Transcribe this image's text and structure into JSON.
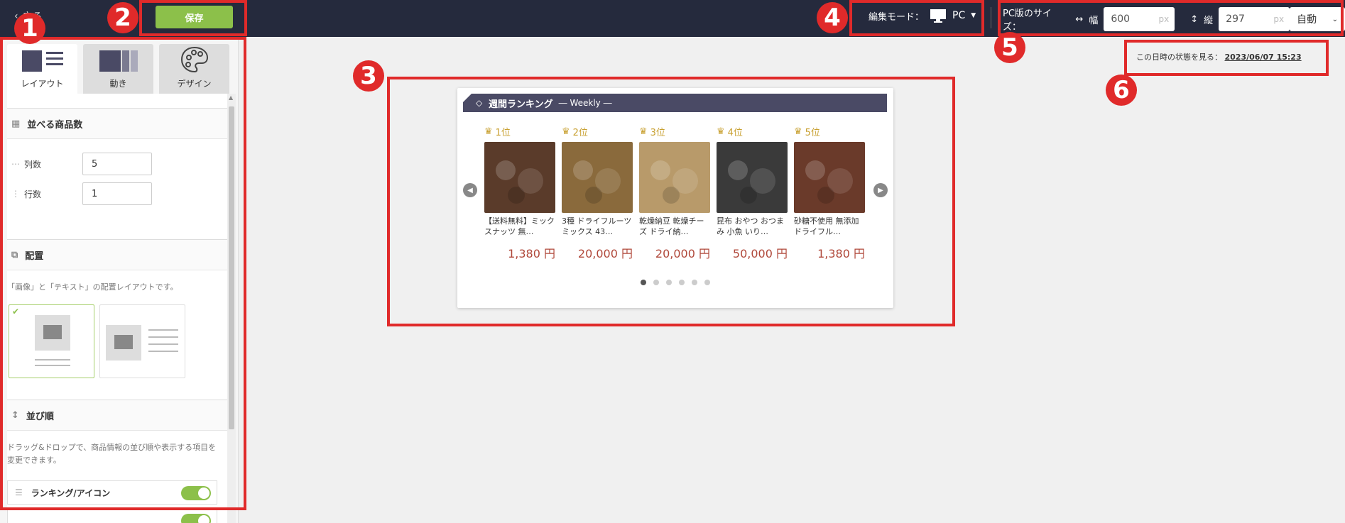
{
  "topbar": {
    "back_label": "戻る",
    "save_label": "保存",
    "edit_mode_label": "編集モード：",
    "edit_mode_value": "PC",
    "size_label": "PC版のサイズ：",
    "width_label": "幅",
    "width_value": "600",
    "height_label": "縦",
    "height_value": "297",
    "unit": "px",
    "height_mode": "自動"
  },
  "annotations": [
    "1",
    "2",
    "3",
    "4",
    "5",
    "6"
  ],
  "tabs": [
    {
      "label": "レイアウト",
      "icon": "layout-icon",
      "active": true
    },
    {
      "label": "動き",
      "icon": "motion-icon",
      "active": false
    },
    {
      "label": "デザイン",
      "icon": "palette-icon",
      "active": false
    }
  ],
  "sections": {
    "count": {
      "title": "並べる商品数",
      "cols_label": "列数",
      "cols_value": "5",
      "rows_label": "行数",
      "rows_value": "1"
    },
    "placement": {
      "title": "配置",
      "desc": "「画像」と「テキスト」の配置レイアウトです。"
    },
    "order": {
      "title": "並び順",
      "desc": "ドラッグ&ドロップで、商品情報の並び順や表示する項目を変更できます。",
      "row1": "ランキング/アイコン"
    }
  },
  "datetime": {
    "label": "この日時の状態を見る：",
    "value": "2023/06/07 15:23"
  },
  "widget": {
    "title": "週間ランキング",
    "subtitle": "― Weekly ―",
    "items": [
      {
        "rank": "1位",
        "name": "【送料無料】ミックスナッツ 無…",
        "price": "1,380 円",
        "color": "#5a3b2a"
      },
      {
        "rank": "2位",
        "name": "3種 ドライフルーツ ミックス 43…",
        "price": "20,000 円",
        "color": "#8a6a3c"
      },
      {
        "rank": "3位",
        "name": "乾燥納豆 乾燥チーズ ドライ納…",
        "price": "20,000 円",
        "color": "#b89a6a"
      },
      {
        "rank": "4位",
        "name": "昆布 おやつ おつまみ 小魚 いり…",
        "price": "50,000 円",
        "color": "#3a3a3a"
      },
      {
        "rank": "5位",
        "name": "砂糖不使用 無添加 ドライフル…",
        "price": "1,380 円",
        "color": "#6a3a2a"
      }
    ],
    "dot_count": 6,
    "active_dot": 0
  },
  "colors": {
    "accent": "#8cc04a",
    "annotation": "#e02a2a",
    "topbar": "#252a3d",
    "price": "#b0483a",
    "rank": "#c8a030"
  }
}
